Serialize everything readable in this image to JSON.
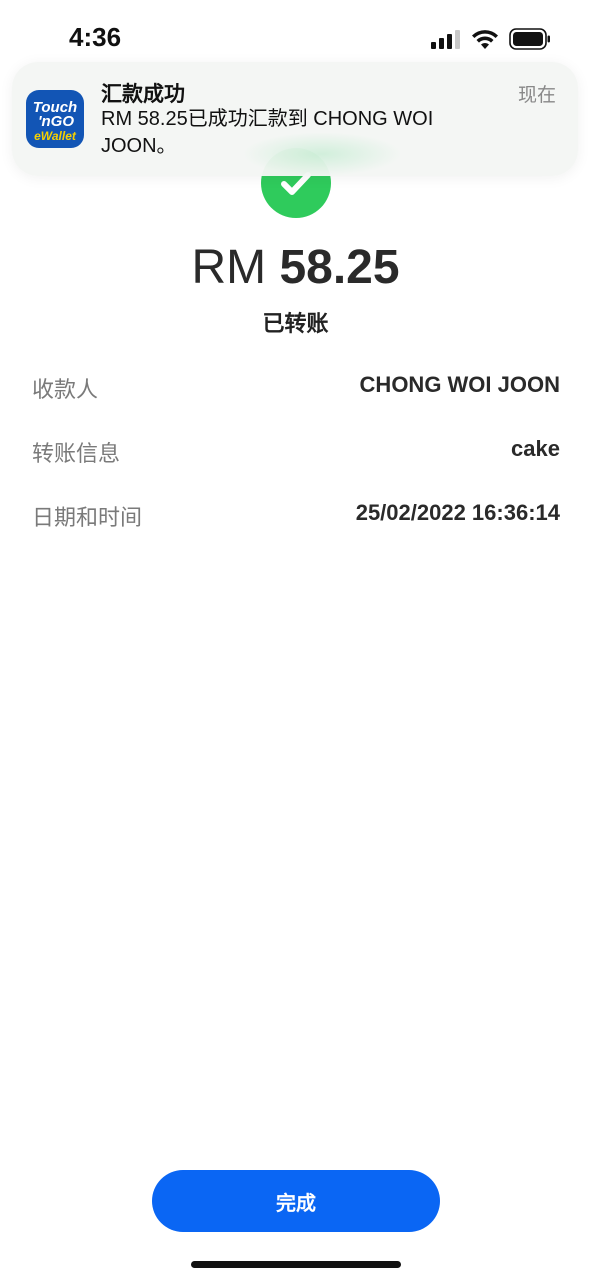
{
  "status_bar": {
    "time": "4:36",
    "icons": [
      "cellular-signal-icon",
      "wifi-icon",
      "battery-icon"
    ]
  },
  "notification": {
    "app_icon": "touch-n-go-ewallet-logo",
    "logo_text": [
      "Touch",
      "'nGO",
      "eWallet"
    ],
    "title": "汇款成功",
    "body": "RM 58.25已成功汇款到 CHONG WOI JOON。",
    "time": "现在"
  },
  "receipt": {
    "status_icon": "check-circle-icon",
    "currency": "RM",
    "amount": "58.25",
    "status": "已转账",
    "details": [
      {
        "label": "收款人",
        "value": "CHONG WOI JOON"
      },
      {
        "label": "转账信息",
        "value": "cake"
      },
      {
        "label": "日期和时间",
        "value": "25/02/2022 16:36:14"
      }
    ]
  },
  "actions": {
    "done_label": "完成"
  },
  "colors": {
    "success_green": "#2fcb5c",
    "primary_blue": "#0a66f4",
    "brand_blue": "#1255b5",
    "brand_yellow": "#f5d000"
  }
}
